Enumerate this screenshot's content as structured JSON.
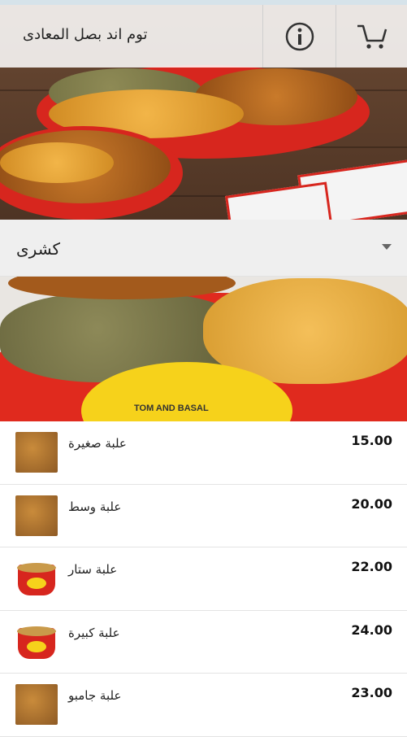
{
  "header": {
    "title": "توم اند بصل المعادى",
    "info_icon": "info-icon",
    "cart_icon": "cart-icon"
  },
  "category": {
    "name": "كشرى",
    "dropdown_icon": "chevron-down-icon"
  },
  "products": [
    {
      "name": "علبة صغيرة",
      "price": "15.00",
      "thumb": "tray"
    },
    {
      "name": "علبة وسط",
      "price": "20.00",
      "thumb": "tray"
    },
    {
      "name": "علبة ستار",
      "price": "22.00",
      "thumb": "cup"
    },
    {
      "name": "علبة كبيرة",
      "price": "24.00",
      "thumb": "cup"
    },
    {
      "name": "علبة جامبو",
      "price": "23.00",
      "thumb": "tray"
    }
  ],
  "banner_brand": "TOM AND BASAL",
  "colors": {
    "accent_red": "#d7261e",
    "header_bg": "#ffffff",
    "category_bg": "#efefef"
  }
}
